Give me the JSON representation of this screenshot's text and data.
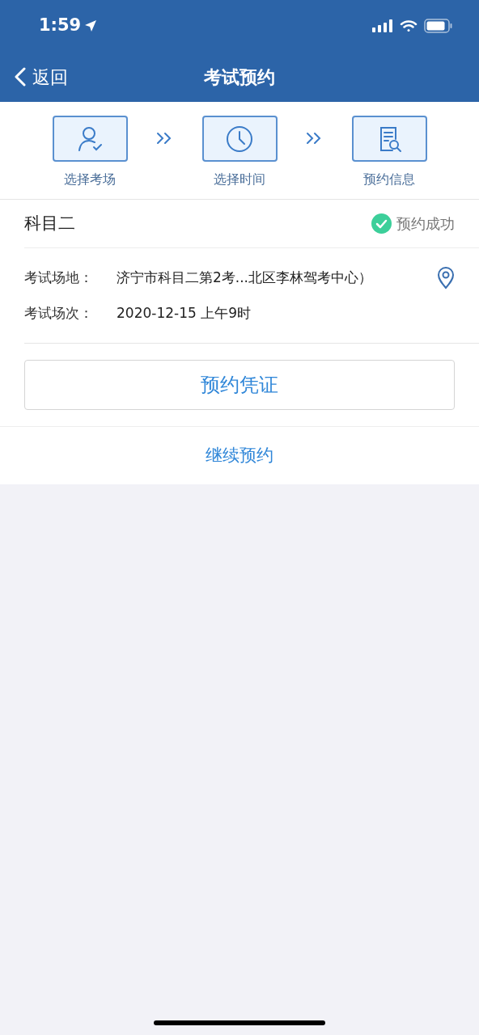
{
  "status_bar": {
    "time": "1:59"
  },
  "nav": {
    "back": "返回",
    "title": "考试预约"
  },
  "steps": [
    {
      "kind": "person",
      "label": "选择考场"
    },
    {
      "kind": "clock",
      "label": "选择时间"
    },
    {
      "kind": "document",
      "label": "预约信息"
    }
  ],
  "subject": {
    "name": "科目二",
    "status": "预约成功"
  },
  "fields": [
    {
      "label": "考试场地：",
      "value": "济宁市科目二第2考...北区李林驾考中心）",
      "has_location": true
    },
    {
      "label": "考试场次：",
      "value": "2020-12-15 上午9时",
      "has_location": false
    }
  ],
  "voucher_button": "预约凭证",
  "continue_link": "继续预约"
}
